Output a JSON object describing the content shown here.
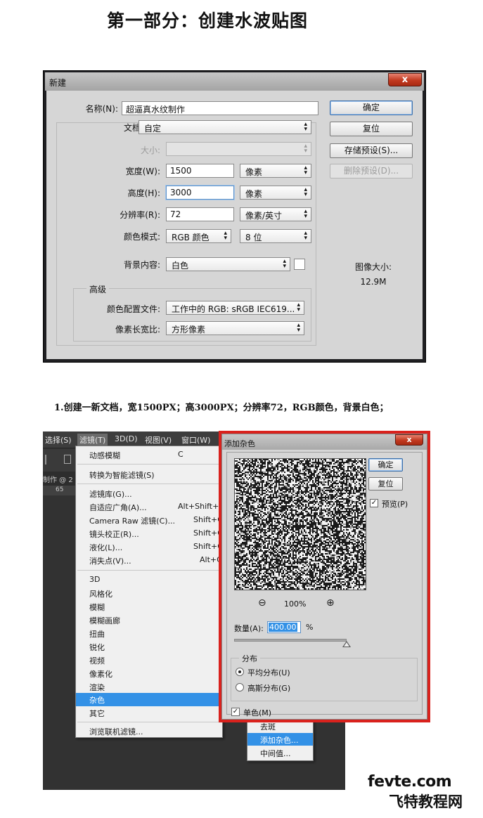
{
  "page_title": "第一部分：创建水波贴图",
  "new_dialog": {
    "title": "新建",
    "close": "x",
    "name_label": "名称(N):",
    "name_value": "超逼真水纹制作",
    "preset_label": "文档类型:",
    "preset_value": "自定",
    "size_label": "大小:",
    "size_value": "",
    "width_label": "宽度(W):",
    "width_value": "1500",
    "width_unit": "像素",
    "height_label": "高度(H):",
    "height_value": "3000",
    "height_unit": "像素",
    "resolution_label": "分辨率(R):",
    "resolution_value": "72",
    "resolution_unit": "像素/英寸",
    "color_mode_label": "颜色模式:",
    "color_mode_value": "RGB 颜色",
    "bit_depth_value": "8 位",
    "background_label": "背景内容:",
    "background_value": "白色",
    "advanced_legend": "高级",
    "color_profile_label": "颜色配置文件:",
    "color_profile_value": "工作中的 RGB: sRGB IEC619...",
    "pixel_aspect_label": "像素长宽比:",
    "pixel_aspect_value": "方形像素",
    "ok_button": "确定",
    "reset_button": "复位",
    "save_preset_button": "存储预设(S)...",
    "delete_preset_button": "删除预设(D)...",
    "image_size_label": "图像大小:",
    "image_size_value": "12.9M"
  },
  "step_text": "1.创建一新文档，宽1500PX；高3000PX；分辨率72，RGB颜色，背景白色；",
  "photoshop": {
    "menubar": [
      "选择(S)",
      "滤镜(T)",
      "3D(D)",
      "视图(V)",
      "窗口(W)"
    ],
    "tab_text": "制作 @ 2",
    "ruler_num": "65",
    "filter_menu": [
      {
        "label": "动感模糊",
        "shortcut": "C"
      },
      {
        "label": "转换为智能滤镜(S)",
        "shortcut": ""
      },
      {
        "label": "滤镜库(G)...",
        "shortcut": ""
      },
      {
        "label": "自适应广角(A)...",
        "shortcut": "Alt+Shift+C"
      },
      {
        "label": "Camera Raw 滤镜(C)...",
        "shortcut": "Shift+C"
      },
      {
        "label": "镜头校正(R)...",
        "shortcut": "Shift+C"
      },
      {
        "label": "液化(L)...",
        "shortcut": "Shift+C"
      },
      {
        "label": "消失点(V)...",
        "shortcut": "Alt+C"
      },
      {
        "label": "3D",
        "shortcut": ""
      },
      {
        "label": "风格化",
        "shortcut": ""
      },
      {
        "label": "模糊",
        "shortcut": ""
      },
      {
        "label": "模糊画廊",
        "shortcut": ""
      },
      {
        "label": "扭曲",
        "shortcut": ""
      },
      {
        "label": "锐化",
        "shortcut": ""
      },
      {
        "label": "视频",
        "shortcut": ""
      },
      {
        "label": "像素化",
        "shortcut": ""
      },
      {
        "label": "渲染",
        "shortcut": ""
      },
      {
        "label": "杂色",
        "shortcut": ""
      },
      {
        "label": "其它",
        "shortcut": ""
      },
      {
        "label": "浏览联机滤镜...",
        "shortcut": ""
      }
    ],
    "noise_submenu": [
      "去斑",
      "添加杂色...",
      "中间值..."
    ]
  },
  "noise_dialog": {
    "title": "添加杂色",
    "close": "x",
    "ok_button": "确定",
    "reset_button": "复位",
    "preview_label": "预览(P)",
    "preview_checked": true,
    "zoom_value": "100%",
    "amount_label": "数量(A):",
    "amount_value": "400.00",
    "amount_unit": "%",
    "amount_fraction": 1.0,
    "distribution_legend": "分布",
    "uniform_label": "平均分布(U)",
    "gaussian_label": "高斯分布(G)",
    "monochrome_label": "单色(M)",
    "monochrome_checked": true
  },
  "watermark": {
    "line1": "fevte.com",
    "line2": "飞特教程网"
  }
}
